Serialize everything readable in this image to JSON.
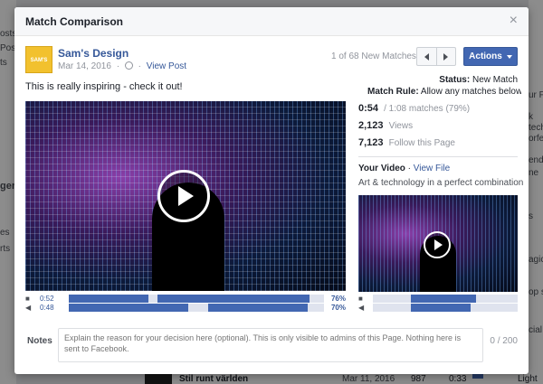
{
  "background": {
    "left_fragments": [
      "osts",
      "Post",
      "ts",
      "ger",
      "es",
      "rts"
    ],
    "right_fragments": [
      "ur Fi",
      "k",
      "techno",
      "orfec",
      "endi",
      "ne",
      "s",
      "agic",
      "op sty",
      "cial"
    ],
    "bottom_row": {
      "title": "Stil runt världen",
      "date": "Mar 11, 2016",
      "count": "987",
      "duration": "0:33",
      "tag": "Light in"
    }
  },
  "modal": {
    "title": "Match Comparison",
    "close_glyph": "×"
  },
  "post": {
    "page_name": "Sam's Design",
    "logo_text": "SAM'S",
    "date": "Mar 14, 2016",
    "separator": "·",
    "view_post": "View Post",
    "text": "This is really inspiring - check it out!"
  },
  "toolbar": {
    "match_count": "1 of 68 New Matches",
    "actions_label": "Actions"
  },
  "status": {
    "label": "Status:",
    "value": "New Match"
  },
  "match_rule": {
    "label": "Match Rule:",
    "value": "Allow any matches below..."
  },
  "stats": {
    "match_time": "0:54",
    "match_detail": "/ 1:08 matches (79%)",
    "views": "2,123",
    "views_label": "Views",
    "follows": "7,123",
    "follows_label": "Follow this Page"
  },
  "your_video": {
    "label": "Your Video",
    "separator": "·",
    "view_file": "View File",
    "description": "Art & technology in a perfect combination"
  },
  "timeline_main": {
    "video_time": "0:52",
    "audio_time": "0:48",
    "video_pct": "76%",
    "audio_pct": "70%",
    "video_icon": "video-camera-icon",
    "audio_icon": "speaker-icon"
  },
  "notes": {
    "label": "Notes",
    "placeholder": "Explain the reason for your decision here (optional). This is only visible to admins of this Page. Nothing here is sent to Facebook.",
    "count": "0 / 200"
  },
  "colors": {
    "accent": "#4267b2",
    "link": "#365899",
    "track": "#dfe3ee"
  }
}
